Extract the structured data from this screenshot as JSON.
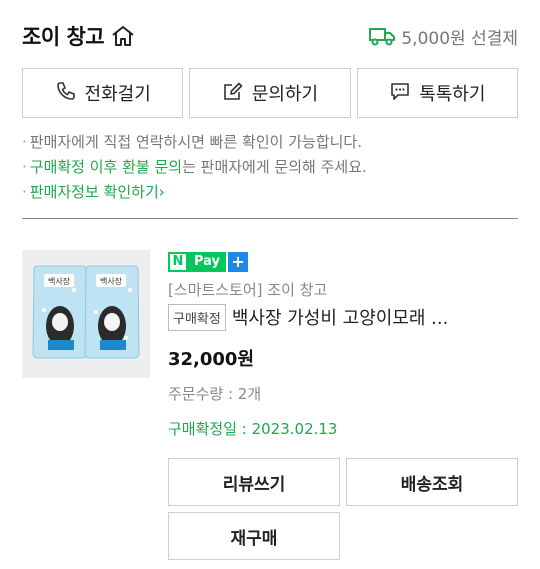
{
  "header": {
    "store_name": "조이 창고",
    "shipping_text": "5,000원 선결제",
    "icons": {
      "home": "home-icon",
      "shipping": "truck-icon"
    }
  },
  "contact": {
    "call_label": "전화걸기",
    "inquiry_label": "문의하기",
    "talk_label": "톡톡하기"
  },
  "notes": {
    "line1": "판매자에게 직접 연락하시면 빠른 확인이 가능합니다.",
    "line2_highlight": "구매확정 이후 환불 문의",
    "line2_rest": "는 판매자에게 문의해 주세요.",
    "line3_link": "판매자정보 확인하기",
    "line3_chevron": "›"
  },
  "product": {
    "pay_n": "N",
    "pay_label": "Pay",
    "pay_plus": "+",
    "seller": "[스마트스토어] 조이 창고",
    "status_badge": "구매확정",
    "title": "백사장 가성비 고양이모래 ...",
    "price": "32,000원",
    "quantity": "주문수량 : 2개",
    "confirm_date": "구매확정일 : 2023.02.13",
    "image_label": "백사장"
  },
  "actions": {
    "review": "리뷰쓰기",
    "tracking": "배송조회",
    "reorder": "재구매"
  },
  "colors": {
    "accent_green": "#1fa84f",
    "npay_green": "#03c75a",
    "plus_blue": "#1e88e5"
  }
}
